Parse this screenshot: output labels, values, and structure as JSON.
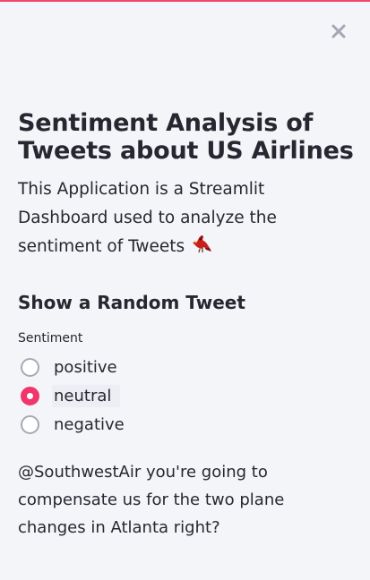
{
  "sidebar": {
    "close_icon": "close-icon",
    "title": "Sentiment Analysis of Tweets about US Airlines",
    "description": "This Application is a Streamlit Dashboard used to analyze the sentiment of Tweets",
    "description_emoji": "bird-emoji",
    "subheader": "Show a Random Tweet",
    "sentiment_radio": {
      "label": "Sentiment",
      "options": [
        "positive",
        "neutral",
        "negative"
      ],
      "selected": "neutral"
    },
    "random_tweet": "@SouthwestAir you're going to compensate us for the two plane changes in Atlanta right?"
  },
  "colors": {
    "accent": "#f0376b",
    "background": "#f4f5f8",
    "text": "#262730",
    "radio_border": "#a7a9b5"
  }
}
